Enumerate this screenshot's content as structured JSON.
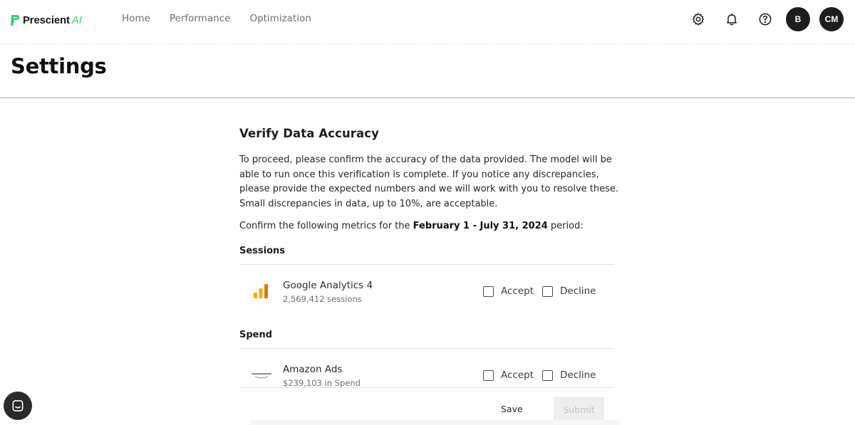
{
  "brand": {
    "name": "Prescient",
    "suffix": "AI",
    "accent": "#2fd36b"
  },
  "nav": {
    "links": [
      "Home",
      "Performance",
      "Optimization"
    ],
    "icons": [
      "gear-icon",
      "bell-icon",
      "help-icon"
    ],
    "avatars": [
      "B",
      "CM"
    ]
  },
  "page": {
    "title": "Settings"
  },
  "verify": {
    "heading": "Verify Data Accuracy",
    "intro": "To proceed, please confirm the accuracy of the data provided. The model will be able to run once this verification is complete. If you notice any discrepancies, please provide the expected numbers and we will work with you to resolve these. Small discrepancies in data, up to 10%, are acceptable.",
    "confirm_prefix": "Confirm the following metrics for the",
    "period": "February 1 - July 31, 2024",
    "confirm_suffix": "period:",
    "sections": [
      {
        "label": "Sessions",
        "rows": [
          {
            "name": "Google Analytics 4",
            "detail": "2,569,412 sessions",
            "logo": "google-analytics-logo",
            "accept": "Accept",
            "decline": "Decline",
            "accepted": false,
            "declined": false
          }
        ]
      },
      {
        "label": "Spend",
        "rows": [
          {
            "name": "Amazon Ads",
            "detail": "$239,103 in Spend",
            "logo": "amazon-ads-logo",
            "accept": "Accept",
            "decline": "Decline",
            "accepted": false,
            "declined": false
          }
        ]
      }
    ],
    "save_label": "Save",
    "submit_label": "Submit"
  },
  "chat": {
    "icon": "chat-icon"
  }
}
